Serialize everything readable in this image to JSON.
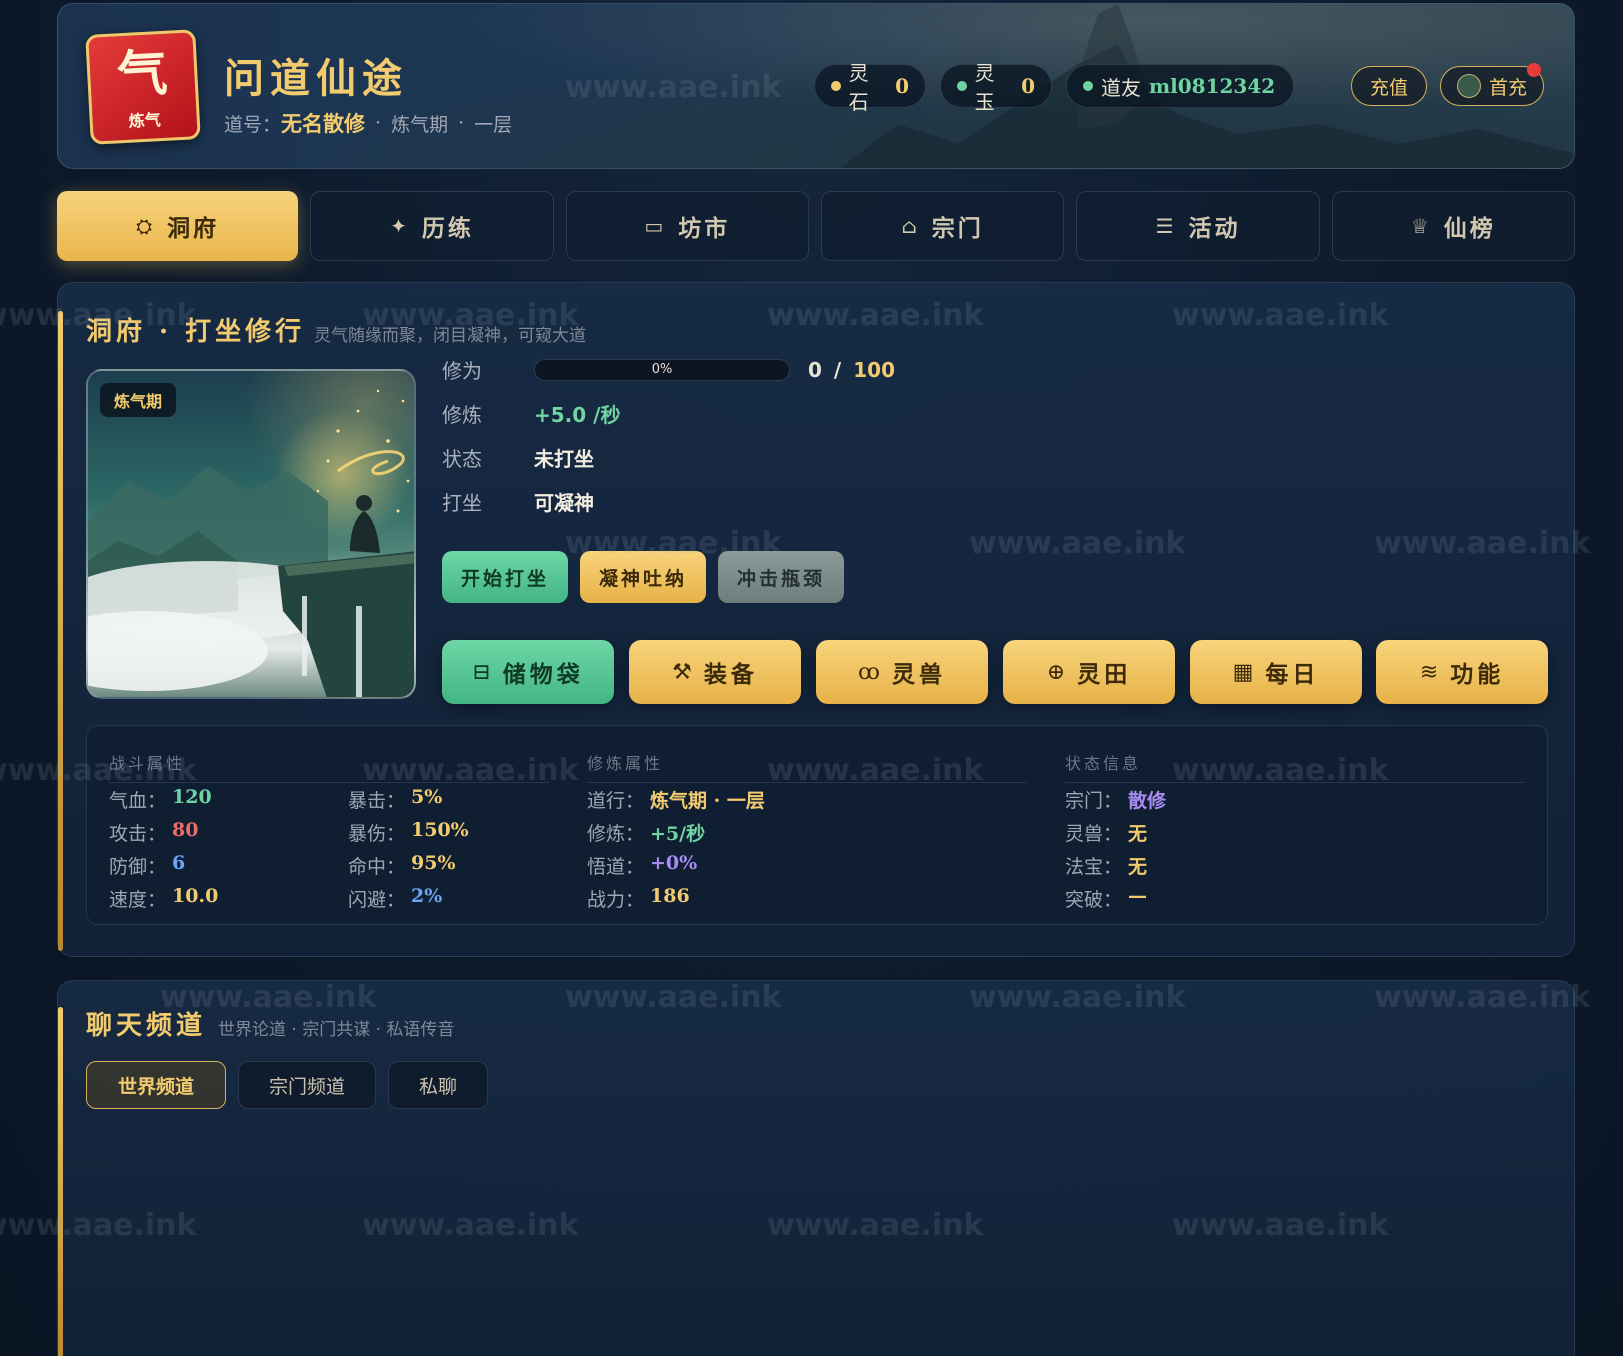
{
  "header": {
    "logo_char": "气",
    "logo_realm": "炼气",
    "title": "问道仙途",
    "dao_label": "道号：",
    "dao_name": "无名散修",
    "realm": "炼气期",
    "layer": "一层",
    "sep": "·",
    "lingshi_label": "灵石",
    "lingshi_value": "0",
    "lingyu_label": "灵玉",
    "lingyu_value": "0",
    "friend_label": "道友",
    "friend_name": "ml0812342",
    "recharge_label": "充值",
    "first_recharge_label": "首充"
  },
  "nav": {
    "tabs": [
      {
        "label": "洞府",
        "icon": "sparkle-icon"
      },
      {
        "label": "历练",
        "icon": "star-icon"
      },
      {
        "label": "坊市",
        "icon": "archive-icon"
      },
      {
        "label": "宗门",
        "icon": "home-icon"
      },
      {
        "label": "活动",
        "icon": "list-icon"
      },
      {
        "label": "仙榜",
        "icon": "trophy-icon"
      }
    ],
    "active_index": 0
  },
  "cave": {
    "title": "洞府 · 打坐修行",
    "subtitle": "灵气随缘而聚，闭目凝神，可窥大道",
    "realm_badge": "炼气期",
    "cultivation_label": "修为",
    "cultivation_percent": "0%",
    "cultivation_fraction": 0,
    "cultivation_current": "0",
    "cultivation_sep": "/",
    "cultivation_max": "100",
    "rate_label": "修炼",
    "rate_value": "+5.0 /秒",
    "status_label": "状态",
    "status_value": "未打坐",
    "meditate_label": "打坐",
    "meditate_value": "可凝神",
    "actions": {
      "start": "开始打坐",
      "focus": "凝神吐纳",
      "breakthrough": "冲击瓶颈"
    },
    "functions": [
      {
        "label": "储物袋",
        "icon": "bag-icon"
      },
      {
        "label": "装备",
        "icon": "wrench-icon"
      },
      {
        "label": "灵兽",
        "icon": "beast-icon"
      },
      {
        "label": "灵田",
        "icon": "field-icon"
      },
      {
        "label": "每日",
        "icon": "calendar-icon"
      },
      {
        "label": "功能",
        "icon": "layers-icon"
      }
    ]
  },
  "attributes": {
    "combat_title": "战斗属性",
    "cultivate_title": "修炼属性",
    "status_title": "状态信息",
    "combat": [
      {
        "label": "气血：",
        "value": "120"
      },
      {
        "label": "攻击：",
        "value": "80"
      },
      {
        "label": "防御：",
        "value": "6"
      },
      {
        "label": "速度：",
        "value": "10.0"
      },
      {
        "label": "暴击：",
        "value": "5%"
      },
      {
        "label": "暴伤：",
        "value": "150%"
      },
      {
        "label": "命中：",
        "value": "95%"
      },
      {
        "label": "闪避：",
        "value": "2%"
      }
    ],
    "cultivate": [
      {
        "label": "道行：",
        "value": "炼气期 · 一层"
      },
      {
        "label": "修炼：",
        "value": "+5/秒"
      },
      {
        "label": "悟道：",
        "value": "+0%"
      },
      {
        "label": "战力：",
        "value": "186"
      }
    ],
    "status": [
      {
        "label": "宗门：",
        "value": "散修"
      },
      {
        "label": "灵兽：",
        "value": "无"
      },
      {
        "label": "法宝：",
        "value": "无"
      },
      {
        "label": "突破：",
        "value": "—"
      }
    ]
  },
  "chat": {
    "title": "聊天频道",
    "subtitle": "世界论道 · 宗门共谋 · 私语传音",
    "tabs": [
      "世界频道",
      "宗门频道",
      "私聊"
    ]
  },
  "watermark": "www.aae.ink",
  "colors": {
    "gold": "#f2cb6e",
    "green": "#6fd3a2",
    "red": "#ef6b6b",
    "blue": "#6aa6f3",
    "purple": "#a88cf0",
    "background": "#0d1a2b"
  }
}
